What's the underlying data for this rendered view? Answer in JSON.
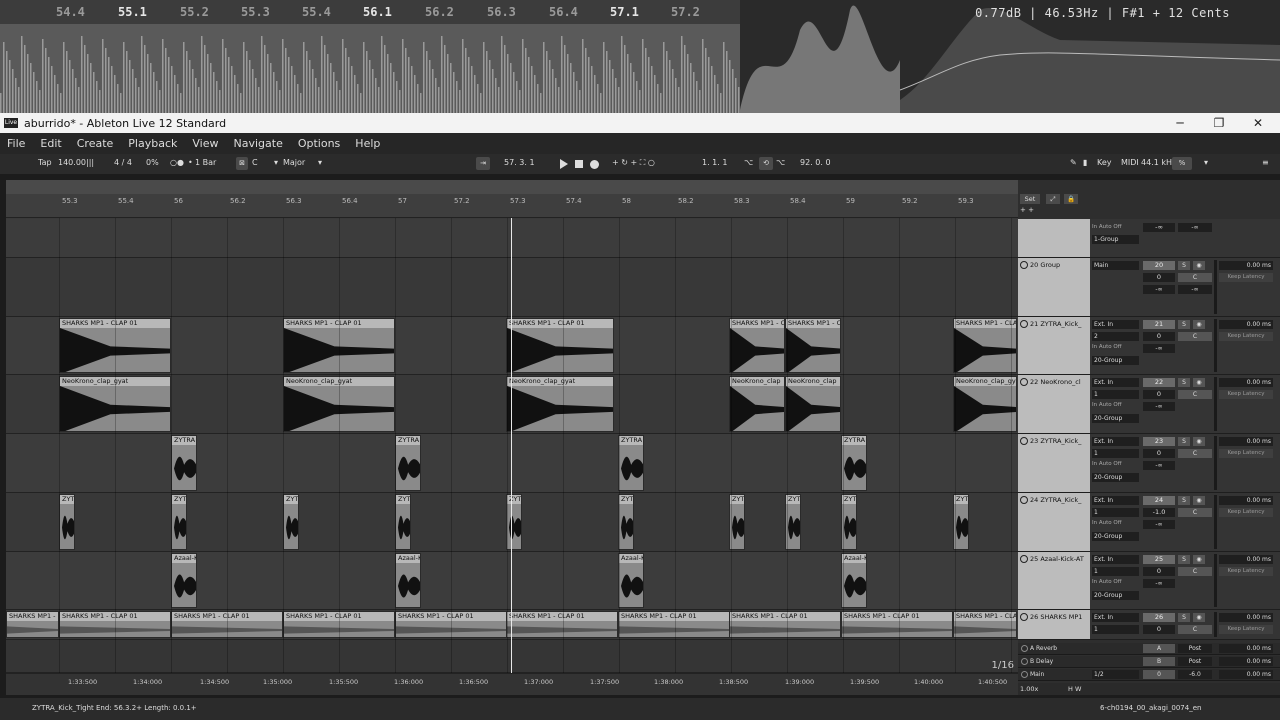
{
  "visualizer": {
    "ticks": [
      "54.4",
      "55.1",
      "55.2",
      "55.3",
      "55.4",
      "56.1",
      "56.2",
      "56.3",
      "56.4",
      "57.1",
      "57.2"
    ],
    "major_ticks": [
      "55.1",
      "56.1",
      "57.1"
    ],
    "readout": "0.77dB | 46.53Hz | F#1 + 12 Cents"
  },
  "window": {
    "title": "aburrido* - Ableton Live 12 Standard",
    "icon": "Live",
    "minimize": "─",
    "maximize": "❐",
    "close": "✕"
  },
  "menu": [
    "File",
    "Edit",
    "Create",
    "Playback",
    "View",
    "Navigate",
    "Options",
    "Help"
  ],
  "control": {
    "tap": "Tap",
    "tempo": "140.00",
    "time_sig": "4 / 4",
    "swing": "0%",
    "quant": "1 Bar",
    "key": "C",
    "scale": "Major",
    "position": "57. 3. 1",
    "loop_start": "1. 1. 1",
    "loop_len": "92. 0. 0",
    "key_map": "Key",
    "midi_map": "MIDI",
    "sample_rate": "44.1 kHz",
    "cpu": "%"
  },
  "arrangement": {
    "ruler": [
      "55.3",
      "55.4",
      "56",
      "56.2",
      "56.3",
      "56.4",
      "57",
      "57.2",
      "57.3",
      "57.4",
      "58",
      "58.2",
      "58.3",
      "58.4",
      "59",
      "59.2",
      "59.3"
    ],
    "time_ruler": [
      "1:33:500",
      "1:34:000",
      "1:34:500",
      "1:35:000",
      "1:35:500",
      "1:36:000",
      "1:36:500",
      "1:37:000",
      "1:37:500",
      "1:38:000",
      "1:38:500",
      "1:39:000",
      "1:39:500",
      "1:40:000",
      "1:40:500"
    ],
    "zoom": "1/16",
    "zoom_factor": "1.00x",
    "set_label": "Set",
    "clips": {
      "clap": "SHARKS MP1 - CLAP 01",
      "clap_short": "SHARKS MP1 - C",
      "neo": "NeoKrono_clap_gyat",
      "neo_short": "NeoKrono_clap",
      "zytra": "ZYTRA",
      "zytra_short": "ZYTF",
      "azaal": "Azaal-K"
    }
  },
  "tracks": [
    {
      "name": "",
      "io": "",
      "io2": "",
      "io3": "1-Group",
      "num": "",
      "vol": "-∞",
      "vol2": "-∞"
    },
    {
      "name": "20 Group",
      "io": "Main",
      "num": "20",
      "vol": "0",
      "ms": "0.00",
      "kl": "Keep Latency",
      "vol_a": "-∞",
      "vol_b": "-∞"
    },
    {
      "name": "21 ZYTRA_Kick_",
      "io": "Ext. In",
      "io2": "2",
      "io3": "20-Group",
      "num": "21",
      "vol": "0",
      "ms": "0.00",
      "kl": "Keep Latency",
      "inf": "-∞"
    },
    {
      "name": "22 NeoKrono_cl",
      "io": "Ext. In",
      "io2": "1",
      "io3": "20-Group",
      "num": "22",
      "vol": "0",
      "ms": "0.00",
      "kl": "Keep Latency",
      "inf": "-∞"
    },
    {
      "name": "23 ZYTRA_Kick_",
      "io": "Ext. In",
      "io2": "1",
      "io3": "20-Group",
      "num": "23",
      "vol": "0",
      "ms": "0.00",
      "kl": "Keep Latency",
      "inf": "-∞"
    },
    {
      "name": "24 ZYTRA_Kick_",
      "io": "Ext. In",
      "io2": "1",
      "io3": "20-Group",
      "num": "24",
      "vol": "-1.0",
      "ms": "0.00",
      "kl": "Keep Latency",
      "inf": "-∞"
    },
    {
      "name": "25 Azaal-Kick-AT",
      "io": "Ext. In",
      "io2": "1",
      "io3": "20-Group",
      "num": "25",
      "vol": "0",
      "ms": "0.00",
      "kl": "Keep Latency",
      "inf": "-∞"
    },
    {
      "name": "26 SHARKS MP1",
      "io": "Ext. In",
      "io2": "1",
      "io3": "",
      "num": "26",
      "vol": "0",
      "ms": "0.00",
      "kl": "Keep Latency",
      "inf": "-∞"
    }
  ],
  "monitor": {
    "in": "In",
    "auto": "Auto",
    "off": "Off",
    "s": "S",
    "c": "C"
  },
  "returns": [
    {
      "name": "A Reverb",
      "label": "A",
      "vol": "Post",
      "ms": "0.00"
    },
    {
      "name": "B Delay",
      "label": "B",
      "vol": "Post",
      "ms": "0.00"
    },
    {
      "name": "Main",
      "label": "0",
      "vol": "-6.0",
      "ms": "0.00",
      "io": "1/2"
    }
  ],
  "status": {
    "left": "ZYTRA_Kick_Tight  End: 56.3.2+  Length: 0.0.1+",
    "right": "6-ch0194_00_akagi_0074_en"
  }
}
